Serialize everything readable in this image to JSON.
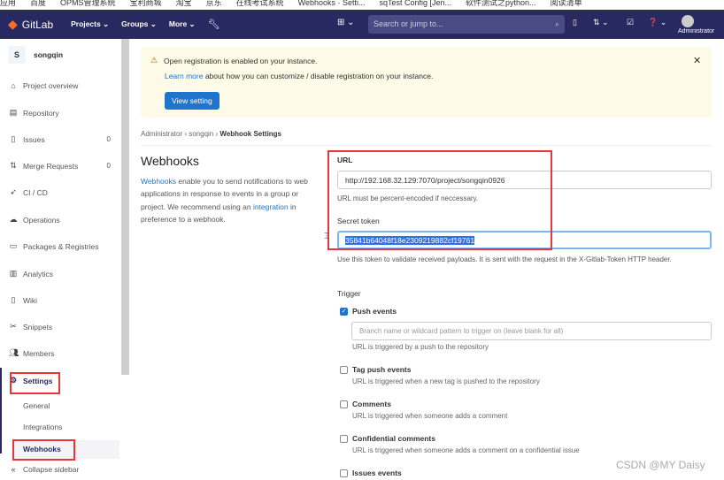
{
  "bookmarks": [
    "应用",
    "百度",
    "OPMS管理系统",
    "宝利商城",
    "淘宝",
    "京东",
    "在线考试系统",
    "Webhooks · Setti...",
    "sqTest Config [Jen...",
    "软件测试之python...",
    "阅读清单"
  ],
  "nav": {
    "brand": "GitLab",
    "projects": "Projects ⌄",
    "groups": "Groups ⌄",
    "more": "More ⌄",
    "search_placeholder": "Search or jump to...",
    "user": "Administrator"
  },
  "sidebar": {
    "project_initial": "S",
    "project_name": "songqin",
    "items": [
      {
        "label": "Project overview",
        "icon": "home"
      },
      {
        "label": "Repository",
        "icon": "doc"
      },
      {
        "label": "Issues",
        "icon": "issues",
        "count": "0"
      },
      {
        "label": "Merge Requests",
        "icon": "merge",
        "count": "0"
      },
      {
        "label": "CI / CD",
        "icon": "rocket"
      },
      {
        "label": "Operations",
        "icon": "cloud"
      },
      {
        "label": "Packages & Registries",
        "icon": "package"
      },
      {
        "label": "Analytics",
        "icon": "chart"
      },
      {
        "label": "Wiki",
        "icon": "book"
      },
      {
        "label": "Snippets",
        "icon": "scissors"
      },
      {
        "label": "Members",
        "icon": "users"
      },
      {
        "label": "Settings",
        "icon": "gear"
      }
    ],
    "sub": [
      "General",
      "Integrations",
      "Webhooks"
    ],
    "collapse": "Collapse sidebar"
  },
  "alert": {
    "title": "Open registration is enabled on your instance.",
    "learn_more": "Learn more",
    "text": " about how you can customize / disable registration on your instance.",
    "button": "View setting"
  },
  "breadcrumb": [
    "Administrator",
    "songqin",
    "Webhook Settings"
  ],
  "intro": {
    "title": "Webhooks",
    "link1": "Webhooks",
    "text1": " enable you to send notifications to web applications in response to events in a group or project. We recommend using an ",
    "link2": "integration",
    "text2": " in preference to a webhook."
  },
  "form": {
    "url_label": "URL",
    "url_value": "http://192.168.32.129:7070/project/songqin0926",
    "url_help": "URL must be percent-encoded if neccessary.",
    "token_label": "Secret token",
    "token_value": "35841b64048f18e2309219882cf19761",
    "token_help": "Use this token to validate received payloads. It is sent with the request in the X-Gitlab-Token HTTP header.",
    "trigger_label": "Trigger",
    "branch_placeholder": "Branch name or wildcard pattern to trigger on (leave blank for all)",
    "triggers": [
      {
        "label": "Push events",
        "help": "URL is triggered by a push to the repository",
        "checked": true
      },
      {
        "label": "Tag push events",
        "help": "URL is triggered when a new tag is pushed to the repository",
        "checked": false
      },
      {
        "label": "Comments",
        "help": "URL is triggered when someone adds a comment",
        "checked": false
      },
      {
        "label": "Confidential comments",
        "help": "URL is triggered when someone adds a comment on a confidential issue",
        "checked": false
      },
      {
        "label": "Issues events",
        "checked": false
      }
    ]
  },
  "watermark": "CSDN @MY Daisy"
}
